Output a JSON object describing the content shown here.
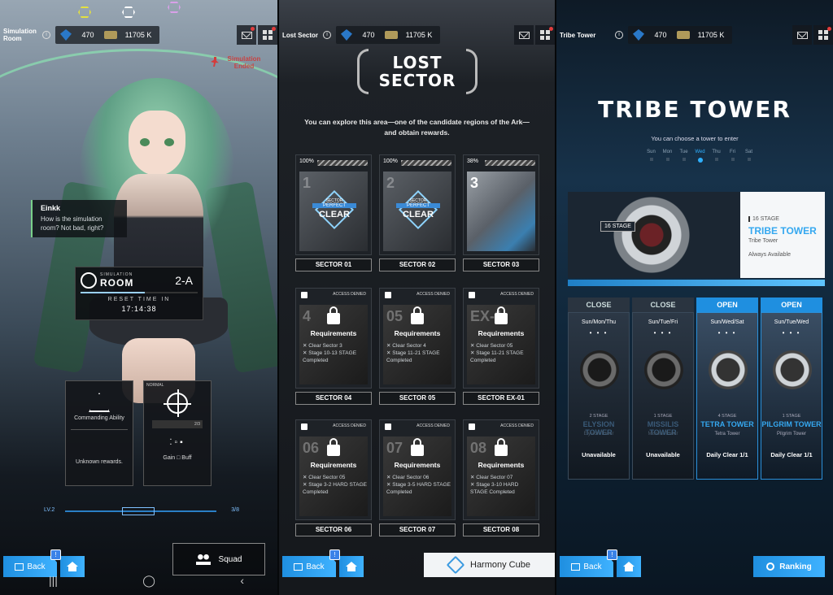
{
  "resources": {
    "gems": "470",
    "credits": "11705 K"
  },
  "panel1": {
    "title": "Simulation Room",
    "sim_status": "Simulation Ended",
    "speaker": "Einkk",
    "dialogue": "How is the simulation room? Not bad, right?",
    "room_sub": "SIMULATION",
    "room_title": "ROOM",
    "room_code": "2-A",
    "reset_label": "RESET TIME IN",
    "reset_time": "17:14:38",
    "card1": {
      "title": "Commanding Ability",
      "desc": "Unknown rewards."
    },
    "card2": {
      "tag": "NORMAL",
      "desc": "Gain □ Buff",
      "count": "2/3"
    },
    "progress_start": "LV.2",
    "progress_end": "3/8",
    "squad": "Squad",
    "back": "Back"
  },
  "panel2": {
    "title": "Lost Sector",
    "heading1": "LOST",
    "heading2": "SECTOR",
    "description1": "You can explore this area—one of the candidate regions of the Ark—",
    "description2": "and obtain rewards.",
    "perfect_top": "SECTOR",
    "perfect_mid": "PERFECT",
    "perfect_bottom": "CLEAR",
    "access_denied": "ACCESS DENIED",
    "requirements": "Requirements",
    "sectors": [
      {
        "num": "1",
        "progress": "100%",
        "label": "SECTOR 01"
      },
      {
        "num": "2",
        "progress": "100%",
        "label": "SECTOR 02"
      },
      {
        "num": "3",
        "progress": "38%",
        "label": "SECTOR 03"
      },
      {
        "num": "4",
        "label": "SECTOR 04",
        "req1": "✕ Clear Sector 3",
        "req2": "✕ Stage 10-13 STAGE Completed"
      },
      {
        "num": "05",
        "label": "SECTOR 05",
        "req1": "✕ Clear Sector 4",
        "req2": "✕ Stage 11-21 STAGE Completed"
      },
      {
        "num": "EX-1",
        "label": "SECTOR EX-01",
        "req1": "✕ Clear Sector 05",
        "req2": "✕ Stage 11-21 STAGE Completed"
      },
      {
        "num": "06",
        "label": "SECTOR 06",
        "req1": "✕ Clear Sector 05",
        "req2": "✕ Stage 3-2 HARD STAGE Completed"
      },
      {
        "num": "07",
        "label": "SECTOR 07",
        "req1": "✕ Clear Sector 06",
        "req2": "✕ Stage 3-5 HARD STAGE Completed"
      },
      {
        "num": "08",
        "label": "SECTOR 08",
        "req1": "✕ Clear Sector 07",
        "req2": "✕ Stage 3-10 HARD STAGE Completed"
      }
    ],
    "back": "Back",
    "harmony_cube": "Harmony Cube"
  },
  "panel3": {
    "title": "Tribe Tower",
    "heading": "TRIBE TOWER",
    "subtitle": "You can choose a tower to enter",
    "days": [
      "Sun",
      "Mon",
      "Tue",
      "Wed",
      "Thu",
      "Fri",
      "Sat"
    ],
    "feature": {
      "stage_badge": "16 STAGE",
      "stage": "16 STAGE",
      "name": "TRIBE TOWER",
      "sub": "Tribe Tower",
      "availability": "Always Available"
    },
    "towers": [
      {
        "head": "CLOSE",
        "days": "Sun/Mon/Thu",
        "dots": "• • •",
        "stage": "2 STAGE",
        "name": "ELYSION TOWER",
        "sub": "Elysion Tower",
        "status": "Unavailable"
      },
      {
        "head": "CLOSE",
        "days": "Sun/Tue/Fri",
        "dots": "• • •",
        "stage": "1 STAGE",
        "name": "MISSILIS TOWER",
        "sub": "Missilis Tower",
        "status": "Unavailable"
      },
      {
        "head": "OPEN",
        "days": "Sun/Wed/Sat",
        "dots": "• • •",
        "stage": "4 STAGE",
        "name": "TETRA TOWER",
        "sub": "Tetra Tower",
        "status": "Daily Clear  1/1"
      },
      {
        "head": "OPEN",
        "days": "Sun/Tue/Wed",
        "dots": "• • •",
        "stage": "1 STAGE",
        "name": "PILGRIM TOWER",
        "sub": "Pilgrim Tower",
        "status": "Daily Clear  1/1"
      }
    ],
    "back": "Back",
    "ranking": "Ranking"
  }
}
